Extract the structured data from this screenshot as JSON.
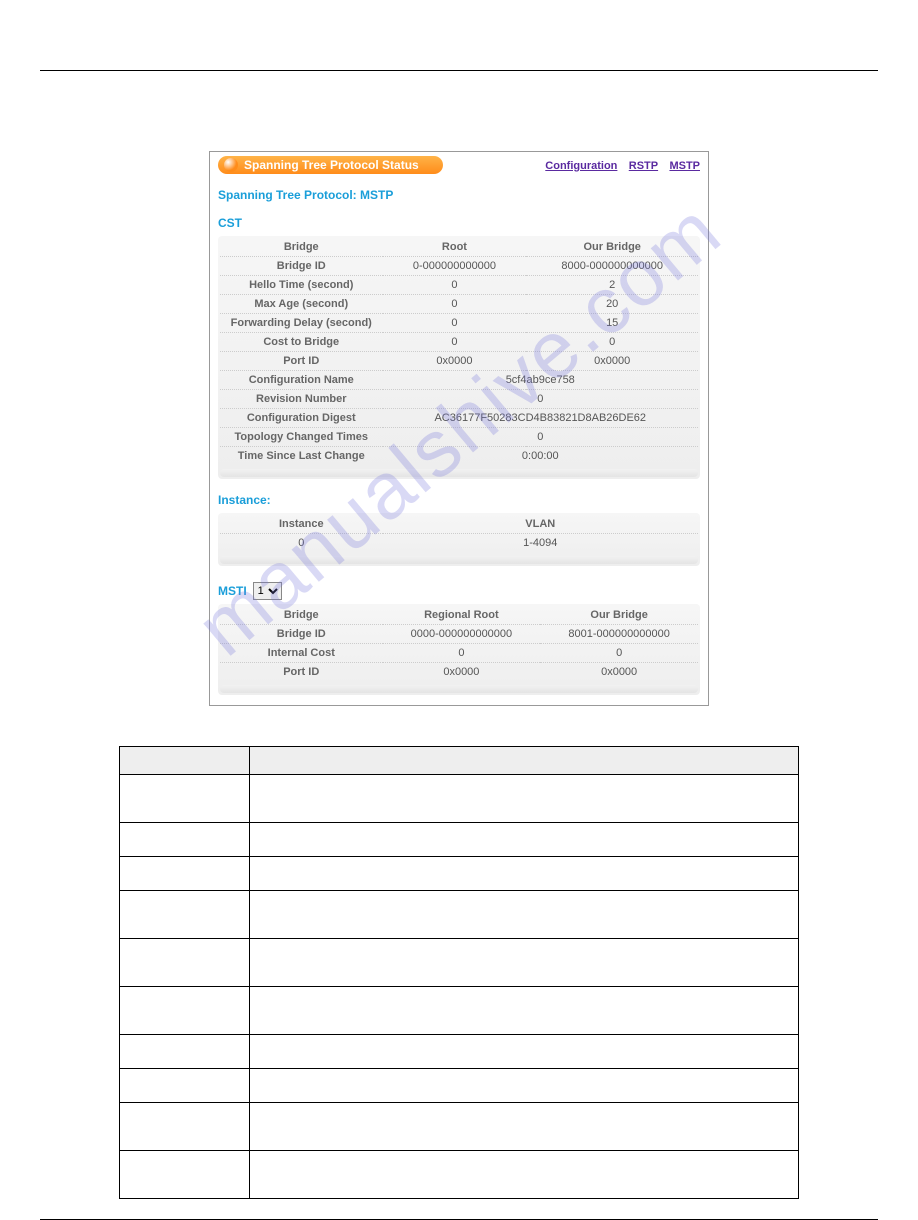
{
  "watermark": "manualshive.com",
  "panel": {
    "title": "Spanning Tree Protocol Status",
    "links": {
      "configuration": "Configuration",
      "rstp": "RSTP",
      "mstp": "MSTP"
    },
    "protocol_line": "Spanning Tree Protocol: MSTP",
    "cst": {
      "heading": "CST",
      "cols": {
        "bridge": "Bridge",
        "root": "Root",
        "our": "Our Bridge"
      },
      "rows": {
        "bridge_id": {
          "label": "Bridge ID",
          "root": "0-000000000000",
          "our": "8000-000000000000"
        },
        "hello": {
          "label": "Hello Time (second)",
          "root": "0",
          "our": "2"
        },
        "max_age": {
          "label": "Max Age (second)",
          "root": "0",
          "our": "20"
        },
        "fwd_delay": {
          "label": "Forwarding Delay (second)",
          "root": "0",
          "our": "15"
        },
        "cost": {
          "label": "Cost to Bridge",
          "root": "0",
          "our": "0"
        },
        "port_id": {
          "label": "Port ID",
          "root": "0x0000",
          "our": "0x0000"
        },
        "cfg_name": {
          "label": "Configuration Name",
          "span": "5cf4ab9ce758"
        },
        "rev_num": {
          "label": "Revision Number",
          "span": "0"
        },
        "cfg_digest": {
          "label": "Configuration Digest",
          "span": "AC36177F50283CD4B83821D8AB26DE62"
        },
        "topo_changed": {
          "label": "Topology Changed Times",
          "span": "0"
        },
        "since_change": {
          "label": "Time Since Last Change",
          "span": "0:00:00"
        }
      }
    },
    "instance": {
      "heading": "Instance:",
      "cols": {
        "instance": "Instance",
        "vlan": "VLAN"
      },
      "row": {
        "instance": "0",
        "vlan": "1-4094"
      }
    },
    "msti": {
      "label": "MSTI",
      "selected": "1",
      "cols": {
        "bridge": "Bridge",
        "regroot": "Regional Root",
        "our": "Our Bridge"
      },
      "rows": {
        "bridge_id": {
          "label": "Bridge ID",
          "regroot": "0000-000000000000",
          "our": "8001-000000000000"
        },
        "int_cost": {
          "label": "Internal Cost",
          "regroot": "0",
          "our": "0"
        },
        "port_id": {
          "label": "Port ID",
          "regroot": "0x0000",
          "our": "0x0000"
        }
      }
    }
  }
}
